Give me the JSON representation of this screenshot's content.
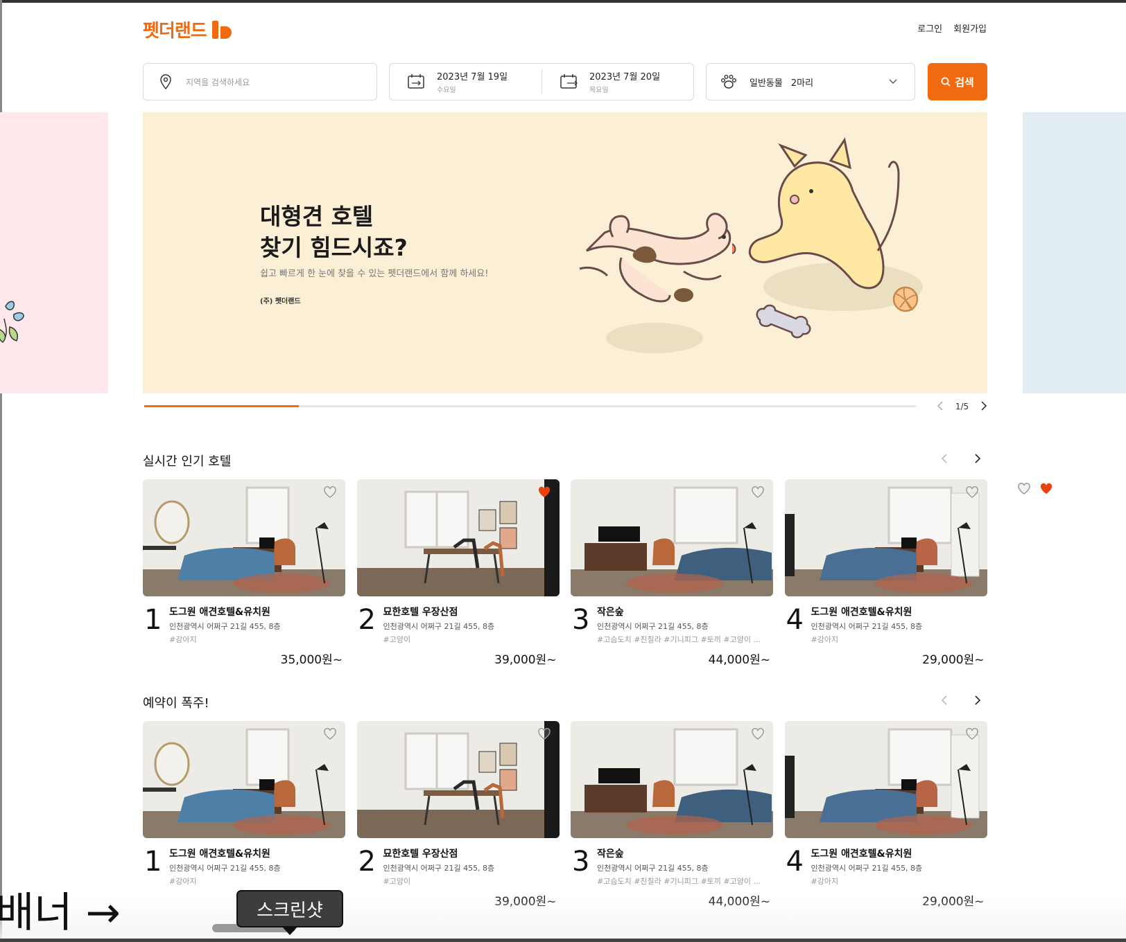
{
  "header": {
    "logo_text": "펫더랜드",
    "login": "로그인",
    "signup": "회원가입"
  },
  "search": {
    "location_placeholder": "지역을 검색하세요",
    "checkin_date": "2023년 7월 19일",
    "checkin_day": "수요일",
    "checkout_date": "2023년 7월 20일",
    "checkout_day": "목요일",
    "pet_kind": "일반동물",
    "pet_count": "2마리",
    "button": "검색"
  },
  "banner": {
    "title_line1": "대형견 호텔",
    "title_line2": "찾기 힘드시죠?",
    "subtitle": "쉽고 빠르게 한 눈에 찾을 수 있는 펫더랜드에서 함께 하세요!",
    "company": "(주) 펫더랜드",
    "pager": "1/5",
    "progress": 0.2
  },
  "sections": [
    {
      "title": "실시간 인기 호텔",
      "cards": [
        {
          "rank": "1",
          "name": "도그원 애견호텔&유치원",
          "address": "인천광역시 어쩌구 21길 455, 8층",
          "tags": "#강아지",
          "price": "35,000원~",
          "liked": false
        },
        {
          "rank": "2",
          "name": "묘한호텔 우장산점",
          "address": "인천광역시 어쩌구 21길 455, 8층",
          "tags": "#고양이",
          "price": "39,000원~",
          "liked": true
        },
        {
          "rank": "3",
          "name": "작은숲",
          "address": "인천광역시 어쩌구 21길 455, 8층",
          "tags": "#고슴도치 #친칠라 #기니피그 #토끼 #고양이 ...",
          "price": "44,000원~",
          "liked": false
        },
        {
          "rank": "4",
          "name": "도그원 애견호텔&유치원",
          "address": "인천광역시 어쩌구 21길 455, 8층",
          "tags": "#강아지",
          "price": "29,000원~",
          "liked": false
        }
      ]
    },
    {
      "title": "예약이 폭주!",
      "cards": [
        {
          "rank": "1",
          "name": "도그원 애견호텔&유치원",
          "address": "인천광역시 어쩌구 21길 455, 8층",
          "tags": "#강아지",
          "price": "",
          "liked": false
        },
        {
          "rank": "2",
          "name": "묘한호텔 우장산점",
          "address": "인천광역시 어쩌구 21길 455, 8층",
          "tags": "#고양이",
          "price": "39,000원~",
          "liked": false
        },
        {
          "rank": "3",
          "name": "작은숲",
          "address": "인천광역시 어쩌구 21길 455, 8층",
          "tags": "#고슴도치 #친칠라 #기니피그 #토끼 #고양이 ...",
          "price": "44,000원~",
          "liked": false
        },
        {
          "rank": "4",
          "name": "도그원 애견호텔&유치원",
          "address": "인천광역시 어쩌구 21길 455, 8층",
          "tags": "#강아지",
          "price": "29,000원~",
          "liked": false
        }
      ]
    }
  ],
  "annotation": {
    "label": "배너 →",
    "tooltip": "스크린샷"
  },
  "colors": {
    "accent": "#F26A10",
    "heart_active": "#E8420E",
    "banner_bg": "#FBF0D6",
    "side_left_bg": "#FEE8EC",
    "side_right_bg": "#E2EDF3"
  }
}
